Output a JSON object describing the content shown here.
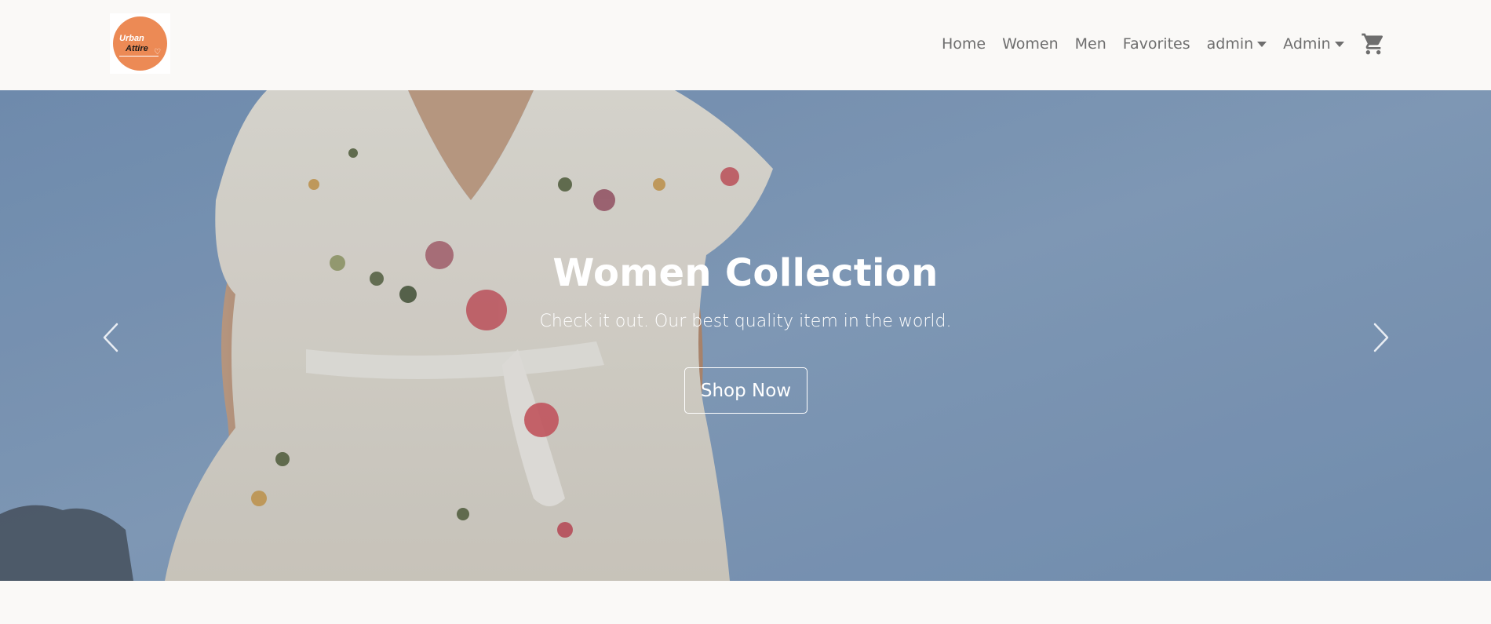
{
  "logo": {
    "line1": "Urban",
    "line2": "Attire",
    "heart": "♡"
  },
  "nav": {
    "items": [
      {
        "label": "Home"
      },
      {
        "label": "Women"
      },
      {
        "label": "Men"
      },
      {
        "label": "Favorites"
      },
      {
        "label": "admin",
        "dropdown": true
      },
      {
        "label": "Admin",
        "dropdown": true
      }
    ],
    "cart_icon": "cart-icon"
  },
  "hero": {
    "title": "Women Collection",
    "subtitle": "Check it out. Our best quality item in the world.",
    "button_label": "Shop Now",
    "prev_icon": "chevron-left-icon",
    "next_icon": "chevron-right-icon"
  },
  "colors": {
    "background": "#faf9f7",
    "nav_text": "#6e6e6e",
    "logo_orange": "#ec8a55",
    "hero_sky": "#7f9bbd",
    "hero_text": "#ffffff"
  }
}
